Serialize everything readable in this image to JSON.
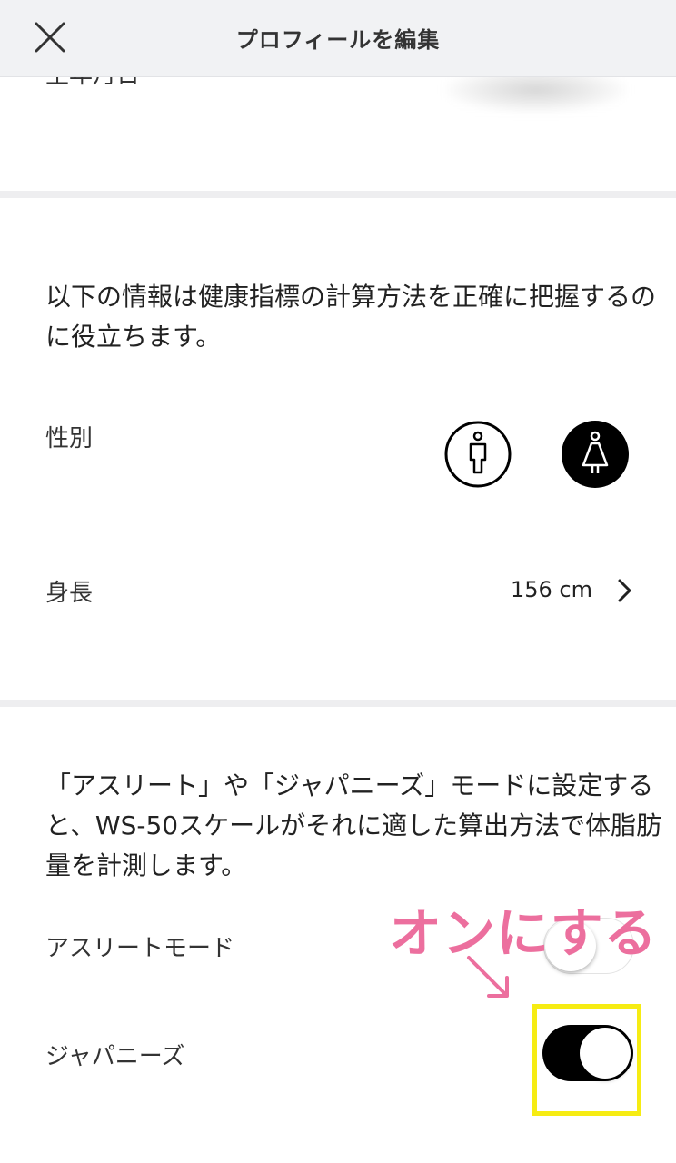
{
  "header": {
    "title": "プロフィールを編集",
    "close_icon": "close-icon"
  },
  "birthday": {
    "label": "生年月日"
  },
  "health_section": {
    "description": "以下の情報は健康指標の計算方法を正確に把握するのに役立ちます。",
    "gender": {
      "label": "性別",
      "options": [
        "male-icon",
        "female-icon"
      ],
      "selected": "female-icon"
    },
    "height": {
      "label": "身長",
      "value": "156 cm"
    }
  },
  "mode_section": {
    "description": "「アスリート」や「ジャパニーズ」モードに設定すると、WS-50スケールがそれに適した算出方法で体脂肪量を計測します。",
    "athlete_mode": {
      "label": "アスリートモード",
      "on": false
    },
    "japanese_mode": {
      "label": "ジャパニーズ",
      "on": true
    }
  },
  "annotation": {
    "text": "オンにする",
    "color": "#ec6f9e",
    "highlight_color": "#f6ec13"
  }
}
